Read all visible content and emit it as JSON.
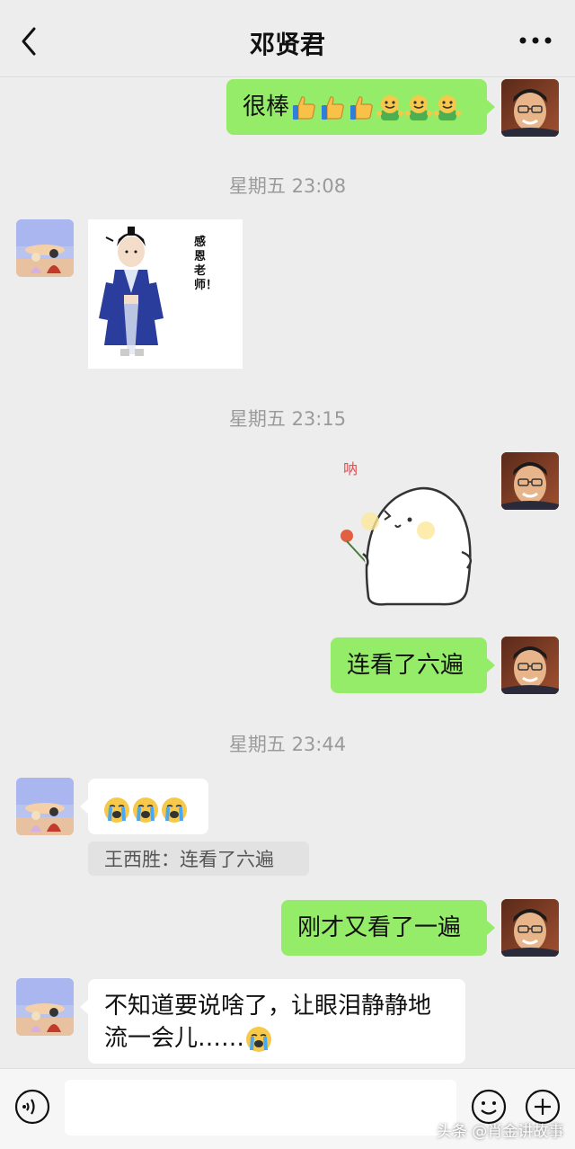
{
  "header": {
    "title": "邓贤君",
    "back_icon": "chevron-left-icon",
    "more_icon": "more-dots-icon"
  },
  "messages": [
    {
      "side": "right",
      "type": "text",
      "text": "很棒",
      "emoji": [
        "thumbs-up",
        "thumbs-up",
        "thumbs-up",
        "grin",
        "grin",
        "grin"
      ]
    },
    {
      "type": "time",
      "text": "星期五 23:08"
    },
    {
      "side": "left",
      "type": "sticker",
      "caption": "感恩老师！"
    },
    {
      "type": "time",
      "text": "星期五 23:15"
    },
    {
      "side": "right",
      "type": "sticker",
      "caption": "呐"
    },
    {
      "side": "right",
      "type": "text",
      "text": "连看了六遍"
    },
    {
      "type": "time",
      "text": "星期五 23:44"
    },
    {
      "side": "left",
      "type": "text",
      "text": "",
      "emoji": [
        "crying-face",
        "crying-face",
        "crying-face"
      ],
      "quote": "王西胜：连看了六遍"
    },
    {
      "side": "right",
      "type": "text",
      "text": "刚才又看了一遍"
    },
    {
      "side": "left",
      "type": "text",
      "line1": "不知道要说啥了，让眼泪静静地",
      "line2": "流一会儿……",
      "emoji": [
        "crying-face"
      ]
    }
  ],
  "input_bar": {
    "voice_icon": "voice-icon",
    "emoji_icon": "emoji-icon",
    "plus_icon": "plus-icon"
  },
  "watermark": "头条 @肖金讲故事",
  "colors": {
    "bubble_green": "#95ec69",
    "bubble_white": "#ffffff",
    "background": "#ededed",
    "timestamp": "#9a9a9a"
  }
}
